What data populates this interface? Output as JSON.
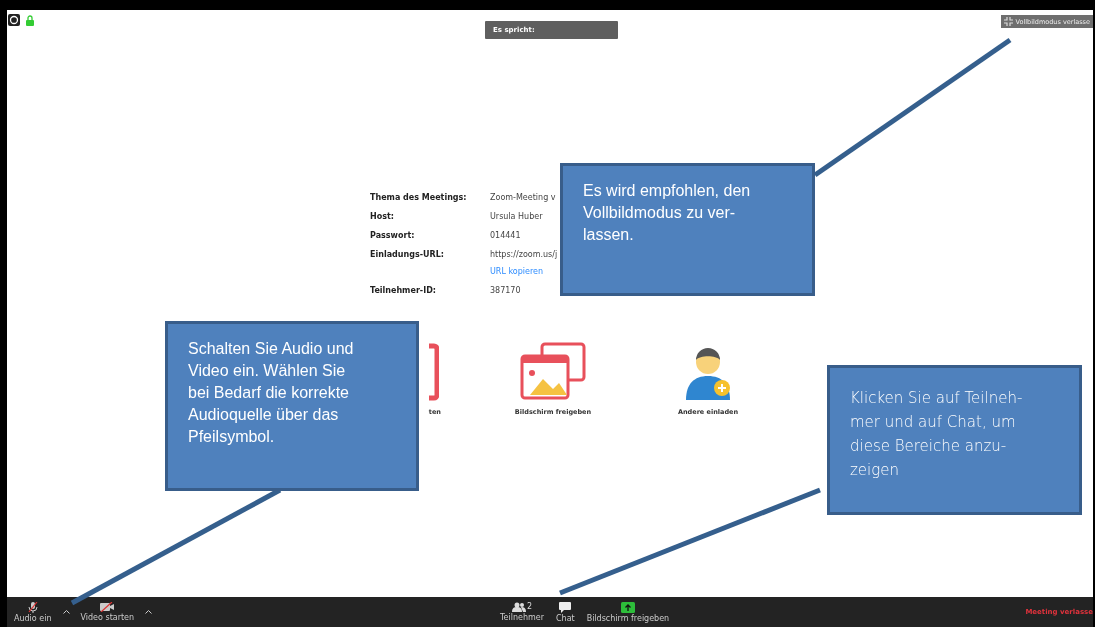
{
  "top_bar": {
    "speaker_label": "Es spricht:",
    "exit_fullscreen": "Vollbildmodus verlasse"
  },
  "meeting_info": [
    {
      "label": "Thema des Meetings:",
      "value": "Zoom-Meeting v"
    },
    {
      "label": "Host:",
      "value": "Ursula Huber"
    },
    {
      "label": "Passwort:",
      "value": "014441"
    },
    {
      "label": "Einladungs-URL:",
      "value": "https://zoom.us/j",
      "link": "URL kopieren"
    },
    {
      "label": "Teilnehmer-ID:",
      "value": "387170"
    }
  ],
  "actions": [
    {
      "kind": "start",
      "label": "ten"
    },
    {
      "kind": "share",
      "label": "Bildschirm freigeben"
    },
    {
      "kind": "invite",
      "label": "Andere einladen"
    }
  ],
  "toolbar": {
    "left": [
      {
        "kind": "mic",
        "label": "Audio ein"
      },
      {
        "kind": "video",
        "label": "Video starten"
      }
    ],
    "center": [
      {
        "kind": "participants",
        "label": "Teilnehmer",
        "count": "2"
      },
      {
        "kind": "chat",
        "label": "Chat"
      },
      {
        "kind": "share",
        "label": "Bildschirm freigeben"
      }
    ],
    "leave": "Meeting verlasse"
  },
  "callouts": [
    {
      "kind": "regular",
      "lines": [
        "Es wird empfohlen, den",
        "Vollbildmodus zu ver-",
        "lassen."
      ]
    },
    {
      "kind": "regular",
      "lines": [
        "Schalten Sie Audio und",
        "Video ein. Wählen Sie",
        "bei Bedarf die korrekte",
        "Audioquelle über das",
        "Pfeilsymbol."
      ]
    },
    {
      "kind": "light",
      "lines": [
        "Klicken Sie auf Teilneh-",
        "mer und auf Chat, um",
        "diese Bereiche anzu-",
        "zeigen"
      ]
    }
  ]
}
